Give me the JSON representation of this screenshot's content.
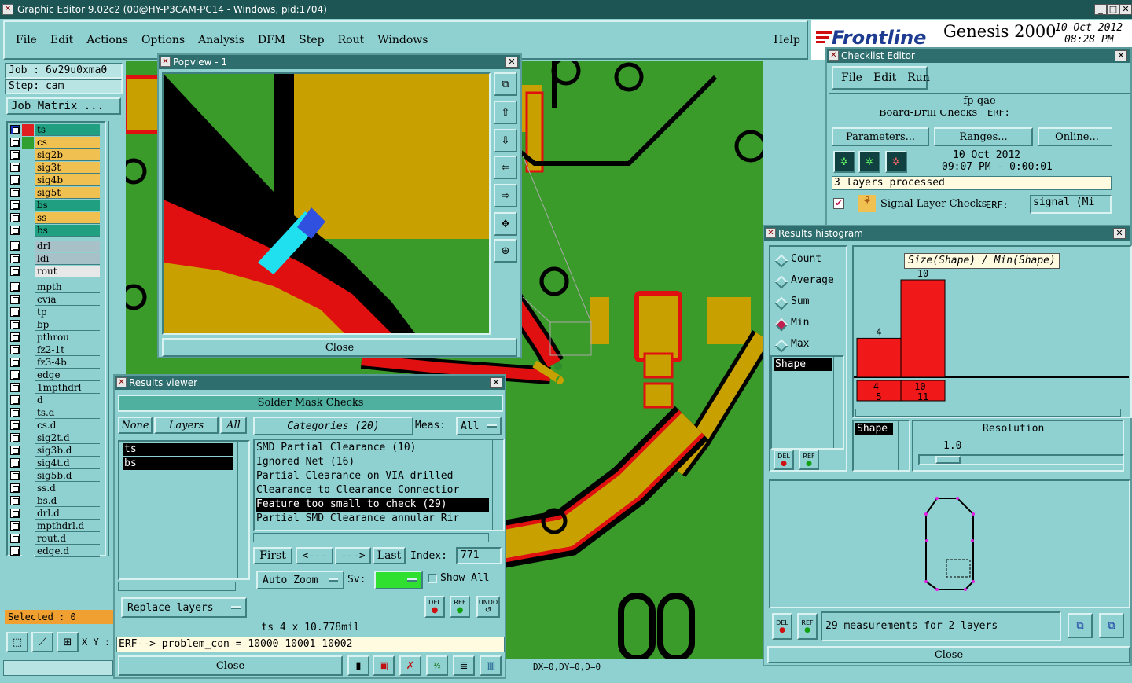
{
  "app": {
    "title": "Graphic Editor 9.02c2 (00@HY-P3CAM-PC14 - Windows, pid:1704)",
    "menus": [
      "File",
      "Edit",
      "Actions",
      "Options",
      "Analysis",
      "DFM",
      "Step",
      "Rout",
      "Windows"
    ],
    "help": "Help",
    "brand": "Frontline",
    "product": "Genesis 2000",
    "date": "10 Oct 2012",
    "time": "08:28 PM"
  },
  "left_panel": {
    "job": "Job : 6v29u0xma0",
    "step": "Step: cam",
    "job_matrix": "Job Matrix ...",
    "selected": "Selected : 0",
    "xy_label": "X Y :",
    "layers_board": [
      {
        "name": "ts",
        "color": "#20a080",
        "swatch": "#e02020"
      },
      {
        "name": "cs",
        "color": "#f0c050",
        "swatch": "#30a030"
      },
      {
        "name": "sig2b",
        "color": "#f0c050",
        "swatch": ""
      },
      {
        "name": "sig3t",
        "color": "#f0c050",
        "swatch": ""
      },
      {
        "name": "sig4b",
        "color": "#f0c050",
        "swatch": ""
      },
      {
        "name": "sig5t",
        "color": "#f0c050",
        "swatch": ""
      },
      {
        "name": "bs",
        "color": "#20a080",
        "swatch": ""
      },
      {
        "name": "ss",
        "color": "#f0c050",
        "swatch": ""
      },
      {
        "name": "bs",
        "color": "#20a080",
        "swatch": ""
      }
    ],
    "layers_drill": [
      "drl",
      "ldi",
      "rout"
    ],
    "layers_misc": [
      "mpth",
      "cvia",
      "tp",
      "bp",
      "pthrou",
      "fz2-1t",
      "fz3-4b",
      "edge",
      "1mpthdrl",
      "d",
      "ts.d",
      "cs.d",
      "sig2t.d",
      "sig3b.d",
      "sig4t.d",
      "sig5b.d",
      "ss.d",
      "bs.d",
      "drl.d",
      "mpthdrl.d",
      "rout.d",
      "edge.d"
    ]
  },
  "popview": {
    "title": "Popview - 1",
    "close": "Close"
  },
  "results_viewer": {
    "title": "Results viewer",
    "heading": "Solder Mask Checks",
    "none": "None",
    "layers": "Layers",
    "all": "All",
    "categories": "Categories (20)",
    "meas_label": "Meas:",
    "meas_value": "All",
    "layer_items": [
      "ts",
      "bs"
    ],
    "category_items": [
      "SMD Partial Clearance (10)",
      "Ignored Net (16)",
      "Partial Clearance on VIA drilled",
      "Clearance to Clearance Connectior",
      "Feature too small to check (29)",
      "Partial SMD Clearance annular Rir"
    ],
    "selected_category": 4,
    "first": "First",
    "prev": "<---",
    "next": "--->",
    "last": "Last",
    "index_label": "Index:",
    "index_value": "771",
    "auto_zoom": "Auto Zoom",
    "sv_label": "Sv:",
    "show_all": "Show All",
    "replace_layers": "Replace layers",
    "del": "DEL",
    "ref": "REF",
    "undo": "UNDO",
    "status": "ts 4 x 10.778mil",
    "erf": "ERF--> problem_con = 10000 10001 10002",
    "close": "Close"
  },
  "bottom_status": {
    "coords": "DX=0,DY=0,D=0"
  },
  "checklist": {
    "title": "Checklist Editor",
    "menus": [
      "File",
      "Edit",
      "Run"
    ],
    "name": "fp-qae",
    "board_drill": "Board-Drill Checks",
    "erf_label": "ERF:",
    "parameters": "Parameters...",
    "ranges": "Ranges...",
    "online": "Online...",
    "run_date": "10 Oct 2012",
    "run_time": "09:07 PM - 0:00:01",
    "processed": "3 layers processed",
    "signal_checks": "Signal Layer Checks",
    "signal_erf": "signal (Mi"
  },
  "histogram": {
    "title": "Results histogram",
    "options": [
      "Count",
      "Average",
      "Sum",
      "Min",
      "Max"
    ],
    "selected_option": 3,
    "list_item": "Shape",
    "chart_title": "Size(Shape) / Min(Shape)",
    "bars": [
      {
        "label": "4-5",
        "label_top": "4-",
        "label_bottom": "5",
        "value": 4
      },
      {
        "label": "10-11",
        "label_top": "10-",
        "label_bottom": "11",
        "value": 10
      }
    ],
    "axis_label": "Shape",
    "resolution_label": "Resolution",
    "resolution_value": "1.0",
    "measurements": "29 measurements for 2 layers",
    "del": "DEL",
    "ref": "REF",
    "close": "Close"
  }
}
